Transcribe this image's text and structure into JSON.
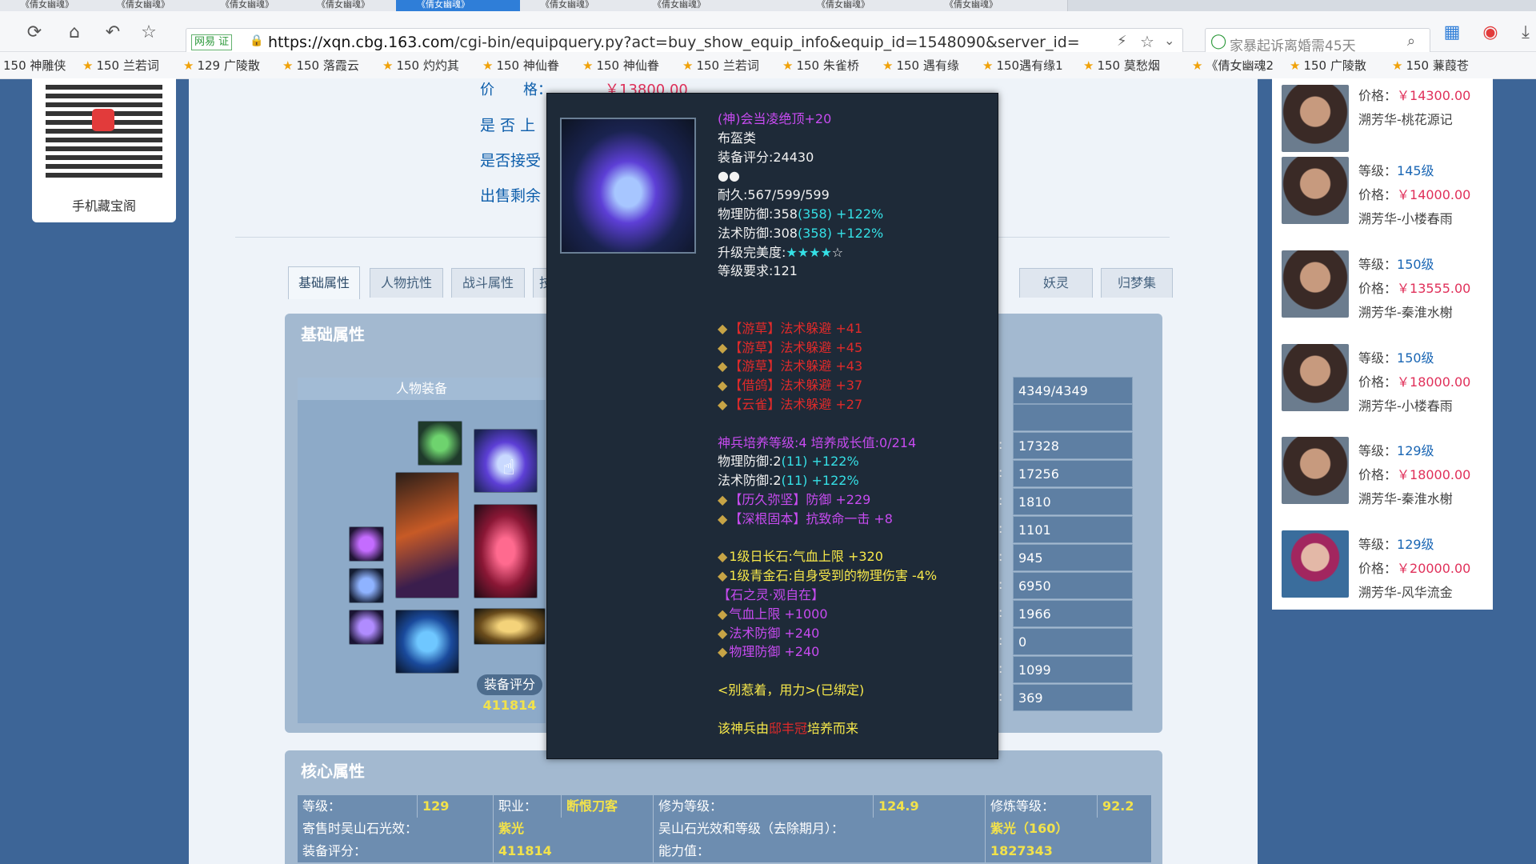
{
  "browser": {
    "tabs": [
      "《倩女幽魂》",
      "《倩女幽魂》",
      "《倩女幽魂》",
      "《倩女幽魂》",
      "《倩女幽魂》",
      "《倩女幽魂》",
      "《倩女幽魂》",
      "《倩女幽魂》",
      "《倩女幽魂》"
    ],
    "url_badge": "网易 证",
    "url_host": "https://xqn.cbg.163.com",
    "url_path": "/cgi-bin/equipquery.py?act=buy_show_equip_info&equip_id=1548090&server_id=",
    "search_placeholder": "家暴起诉离婚需45天",
    "bookmarks": [
      "150 神雕侠",
      "150 兰若词",
      "129 广陵散",
      "150 落霞云",
      "150 灼灼其",
      "150 神仙眷",
      "150 神仙眷",
      "150 兰若词",
      "150 朱雀桥",
      "150 遇有缘",
      "150遇有缘1",
      "150 莫愁烟",
      "《倩女幽魂2",
      "150 广陵散",
      "150 蒹葭苍"
    ]
  },
  "qr": {
    "caption": "手机藏宝阁"
  },
  "info": {
    "price_label": "价　　格：",
    "price_value": "￥13800.00",
    "on_shelf_label": "是 否 上",
    "bargain_label": "是否接受",
    "remain_label": "出售剩余"
  },
  "tabs": [
    "基础属性",
    "人物抗性",
    "战斗属性",
    "技",
    "妖灵",
    "归梦集"
  ],
  "basic": {
    "title": "基础属性",
    "equip_header": "人物装备",
    "score_label": "装备评分",
    "score_value": "411814",
    "stats": [
      "4349/4349",
      "",
      "17328",
      "17256",
      "1810",
      "1101",
      "945",
      "6950",
      "1966",
      "0",
      "1099",
      "369"
    ]
  },
  "core": {
    "title": "核心属性",
    "rows": [
      [
        [
          "等级：",
          "l"
        ],
        [
          "129",
          "v"
        ],
        [
          "职业：",
          "l"
        ],
        [
          "断恨刀客",
          "v"
        ],
        [
          "修为等级：",
          "l"
        ],
        [
          "124.9",
          "v"
        ],
        [
          "修炼等级：",
          "l"
        ],
        [
          "92.2",
          "v"
        ]
      ],
      [
        [
          "寄售时吴山石光效：",
          "l"
        ],
        [
          "紫光",
          "v"
        ],
        [
          "吴山石光效和等级（去除期月）：",
          "l"
        ],
        [
          "紫光（160）",
          "v"
        ]
      ],
      [
        [
          "装备评分：",
          "l"
        ],
        [
          "411814",
          "v"
        ],
        [
          "能力值：",
          "l"
        ],
        [
          "1827343",
          "v"
        ]
      ]
    ]
  },
  "sidebar": {
    "items": [
      {
        "level_label": "",
        "level": "",
        "price_label": "价格：",
        "price": "￥14300.00",
        "name": "溯芳华-桃花源记"
      },
      {
        "level_label": "等级：",
        "level": "145级",
        "price_label": "价格：",
        "price": "￥14000.00",
        "name": "溯芳华-小楼春雨"
      },
      {
        "level_label": "等级：",
        "level": "150级",
        "price_label": "价格：",
        "price": "￥13555.00",
        "name": "溯芳华-秦淮水榭"
      },
      {
        "level_label": "等级：",
        "level": "150级",
        "price_label": "价格：",
        "price": "￥18000.00",
        "name": "溯芳华-小楼春雨"
      },
      {
        "level_label": "等级：",
        "level": "129级",
        "price_label": "价格：",
        "price": "￥18000.00",
        "name": "溯芳华-秦淮水榭"
      },
      {
        "level_label": "等级：",
        "level": "129级",
        "price_label": "价格：",
        "price": "￥20000.00",
        "name": "溯芳华-风华流金"
      }
    ]
  },
  "tooltip": {
    "lines": [
      {
        "segs": [
          [
            "(神)会当凌绝顶+20",
            "p"
          ]
        ]
      },
      {
        "segs": [
          [
            "布盔类",
            "w"
          ]
        ]
      },
      {
        "segs": [
          [
            "装备评分:24430",
            "w"
          ]
        ]
      },
      {
        "segs": [
          [
            "●●",
            "w"
          ]
        ]
      },
      {
        "segs": [
          [
            "耐久:567/599/599",
            "w"
          ]
        ]
      },
      {
        "segs": [
          [
            "物理防御:358",
            "w"
          ],
          [
            "(358) +122%",
            "c"
          ]
        ]
      },
      {
        "segs": [
          [
            "法术防御:308",
            "w"
          ],
          [
            "(358) +122%",
            "c"
          ]
        ]
      },
      {
        "segs": [
          [
            "升级完美度:",
            "w"
          ],
          [
            "★★★★",
            "c"
          ],
          [
            "☆",
            "w"
          ]
        ]
      },
      {
        "segs": [
          [
            "等级要求:121",
            "w"
          ]
        ]
      },
      {
        "segs": [
          [
            "",
            "w"
          ]
        ]
      },
      {
        "segs": [
          [
            "",
            "w"
          ]
        ]
      },
      {
        "segs": [
          [
            "【游草】法术躲避 +41",
            "r"
          ]
        ],
        "bullet": true
      },
      {
        "segs": [
          [
            "【游草】法术躲避 +45",
            "r"
          ]
        ],
        "bullet": true
      },
      {
        "segs": [
          [
            "【游草】法术躲避 +43",
            "r"
          ]
        ],
        "bullet": true
      },
      {
        "segs": [
          [
            "【借鸽】法术躲避 +37",
            "r"
          ]
        ],
        "bullet": true
      },
      {
        "segs": [
          [
            "【云雀】法术躲避 +27",
            "r"
          ]
        ],
        "bullet": true
      },
      {
        "segs": [
          [
            "",
            "w"
          ]
        ]
      },
      {
        "segs": [
          [
            "神兵培养等级:4 培养成长值:0/214",
            "p"
          ]
        ]
      },
      {
        "segs": [
          [
            "物理防御:2",
            "w"
          ],
          [
            "(11) +122%",
            "c"
          ]
        ]
      },
      {
        "segs": [
          [
            "法术防御:2",
            "w"
          ],
          [
            "(11) +122%",
            "c"
          ]
        ]
      },
      {
        "segs": [
          [
            "【历久弥坚】防御 +229",
            "p"
          ]
        ],
        "bullet": true
      },
      {
        "segs": [
          [
            "【深根固本】抗致命一击 +8",
            "p"
          ]
        ],
        "bullet": true
      },
      {
        "segs": [
          [
            "",
            "w"
          ]
        ]
      },
      {
        "segs": [
          [
            "1级日长石:气血上限 +320",
            "y"
          ]
        ],
        "bullet": true
      },
      {
        "segs": [
          [
            "1级青金石:自身受到的物理伤害 -4%",
            "y"
          ]
        ],
        "bullet": true
      },
      {
        "segs": [
          [
            "【石之灵·观自在】",
            "p"
          ]
        ]
      },
      {
        "segs": [
          [
            "气血上限 +1000",
            "p"
          ]
        ],
        "bullet": true
      },
      {
        "segs": [
          [
            "法术防御 +240",
            "p"
          ]
        ],
        "bullet": true
      },
      {
        "segs": [
          [
            "物理防御 +240",
            "p"
          ]
        ],
        "bullet": true
      },
      {
        "segs": [
          [
            "",
            "w"
          ]
        ]
      },
      {
        "segs": [
          [
            "<别惹着，用力>(已绑定)",
            "y"
          ]
        ]
      },
      {
        "segs": [
          [
            "",
            "w"
          ]
        ]
      },
      {
        "segs": [
          [
            "该神兵由",
            "y"
          ],
          [
            "邸丰冠",
            "r"
          ],
          [
            "培养而来",
            "y"
          ]
        ]
      }
    ]
  }
}
